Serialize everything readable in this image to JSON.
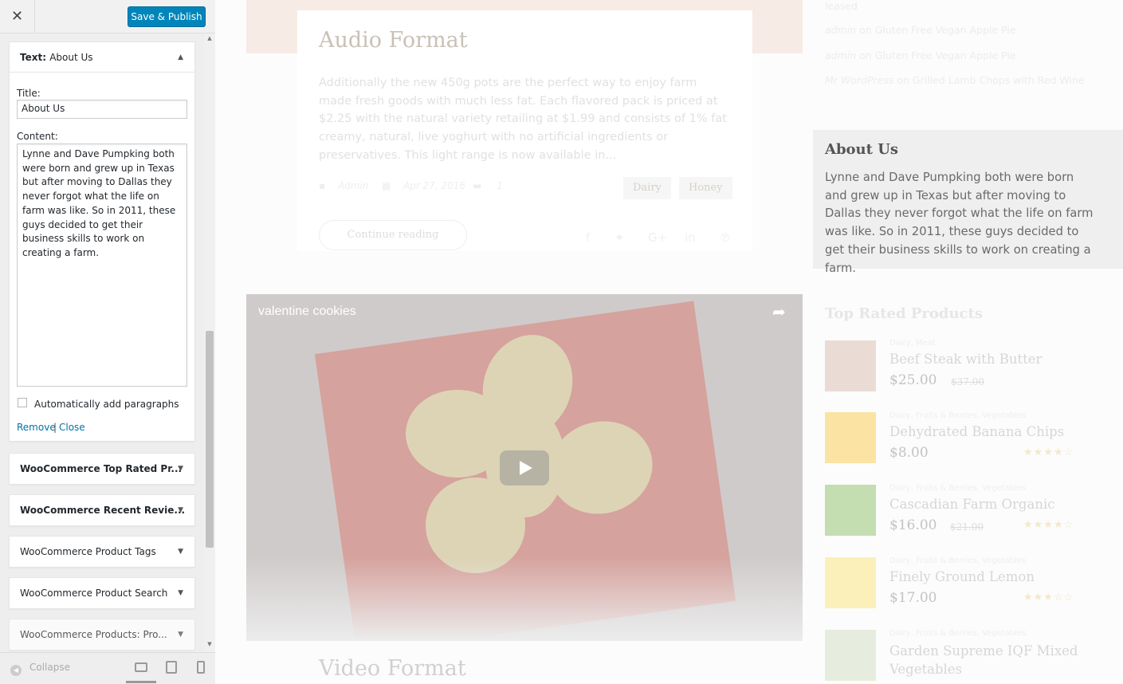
{
  "header": {
    "close_icon": "close-icon",
    "save_label": "Save & Publish"
  },
  "open_widget": {
    "type_label": "Text:",
    "name": "About Us",
    "title_label": "Title:",
    "title_value": "About Us",
    "content_label": "Content:",
    "content_value": "Lynne and Dave Pumpking both were born and grew up in Texas but after moving to Dallas they never forgot what the life on farm was like. So in 2011, these guys decided to get their business skills to work on creating a farm.",
    "auto_p_label": "Automatically add paragraphs",
    "auto_p_checked": false,
    "remove_label": "Remove",
    "close_label": "Close",
    "separator": "|"
  },
  "widgets": [
    {
      "label": "WooCommerce Top Rated Pr..."
    },
    {
      "label": "WooCommerce Recent Revie..."
    },
    {
      "label": "WooCommerce Product Tags"
    },
    {
      "label": "WooCommerce Product Search"
    },
    {
      "label": "WooCommerce Products: Pro..."
    }
  ],
  "footer": {
    "collapse_label": "Collapse"
  },
  "preview": {
    "post": {
      "title": "Audio Format",
      "excerpt": "Additionally the new 450g pots are the perfect way to enjoy farm made fresh goods with much less fat. Each flavored pack is priced at $2.25 with the natural variety retailing at $1.99 and consists of 1% fat creamy, natural, live yoghurt with no artificial ingredients or preservatives. This light range is now available in...",
      "author": "Admin",
      "date": "Apr 27, 2016",
      "comments": "1",
      "tags": [
        "Dairy",
        "Honey"
      ],
      "continue_label": "Continue reading"
    },
    "video": {
      "title": "valentine cookies"
    },
    "next_title": "Video Format",
    "recent_comments": [
      {
        "text": "leased"
      },
      {
        "author": "admin",
        "on": "on",
        "post": "Gluten Free Vegan Apple Pie"
      },
      {
        "author": "admin",
        "on": "on",
        "post": "Gluten Free Vegan Apple Pie"
      },
      {
        "author": "Mr WordPress",
        "on": "on",
        "post": "Grilled Lamb Chops with Red Wine"
      }
    ],
    "about": {
      "title": "About Us",
      "text": "Lynne and Dave Pumpking both were born and grew up in Texas but after moving to Dallas they never forgot what the life on farm was like. So in 2011, these guys decided to get their business skills to work on creating a farm."
    },
    "top_rated": {
      "title": "Top Rated Products",
      "products": [
        {
          "cats": "Dairy, Meat",
          "name": "Beef Steak with Butter",
          "price": "$25.00",
          "old": "$37.00",
          "rating": 0
        },
        {
          "cats": "Dairy, Fruits & Berries, Vegetables",
          "name": "Dehydrated Banana Chips",
          "price": "$8.00",
          "old": "",
          "rating": 4
        },
        {
          "cats": "Dairy, Fruits & Berries, Vegetables",
          "name": "Cascadian Farm Organic",
          "price": "$16.00",
          "old": "$21.00",
          "rating": 4
        },
        {
          "cats": "Dairy, Fruits & Berries, Vegetables",
          "name": "Finely Ground Lemon",
          "price": "$17.00",
          "old": "",
          "rating": 3
        },
        {
          "cats": "Dairy, Fruits & Berries, Vegetables",
          "name": "Garden Supreme IQF Mixed Vegetables",
          "price": "",
          "old": "",
          "rating": 0
        }
      ]
    }
  },
  "colors": {
    "primary_button": "#0085ba",
    "link": "#0073aa"
  }
}
